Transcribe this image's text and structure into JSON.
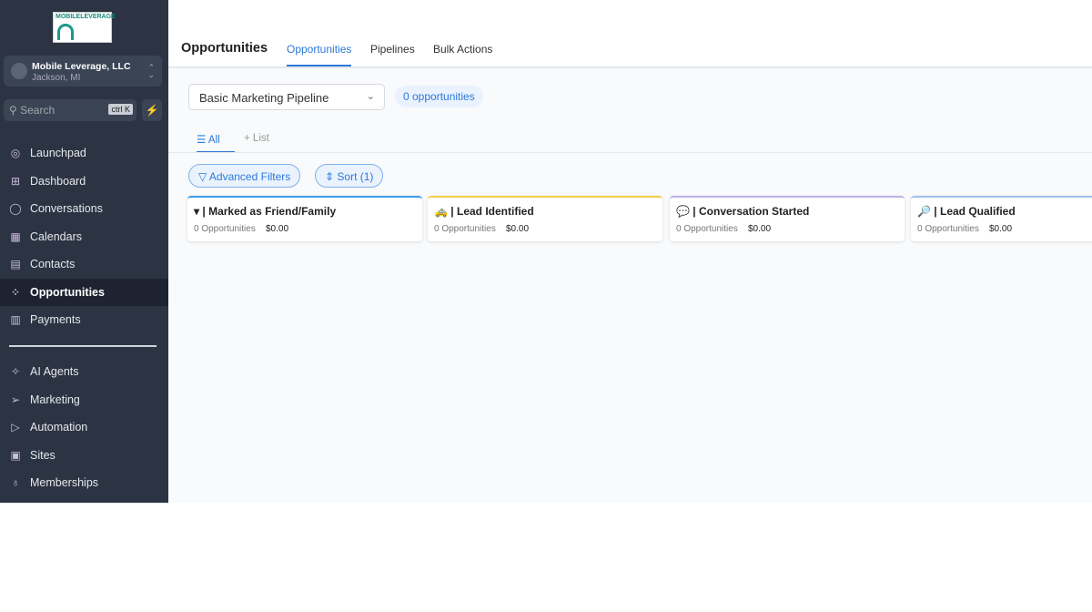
{
  "logo": {
    "text": "MOBILELEVERAGE"
  },
  "account": {
    "name": "Mobile Leverage, LLC",
    "location": "Jackson, MI"
  },
  "search": {
    "placeholder": "Search",
    "shortcut": "ctrl K"
  },
  "nav": [
    {
      "label": "Launchpad",
      "icon": "◎"
    },
    {
      "label": "Dashboard",
      "icon": "⊞"
    },
    {
      "label": "Conversations",
      "icon": "◯"
    },
    {
      "label": "Calendars",
      "icon": "▦"
    },
    {
      "label": "Contacts",
      "icon": "▤"
    },
    {
      "label": "Opportunities",
      "icon": "⁘",
      "active": true
    },
    {
      "label": "Payments",
      "icon": "▥"
    }
  ],
  "nav2": [
    {
      "label": "AI Agents",
      "icon": "✧"
    },
    {
      "label": "Marketing",
      "icon": "➢"
    },
    {
      "label": "Automation",
      "icon": "▷"
    },
    {
      "label": "Sites",
      "icon": "▣"
    },
    {
      "label": "Memberships",
      "icon": "♁"
    }
  ],
  "header": {
    "title": "Opportunities",
    "tabs": [
      "Opportunities",
      "Pipelines",
      "Bulk Actions"
    ]
  },
  "pipeline": {
    "selected": "Basic Marketing Pipeline",
    "count": "0 opportunities"
  },
  "views": {
    "all": "All",
    "list": "List"
  },
  "filters": {
    "advanced": "Advanced Filters",
    "sort": "Sort (1)"
  },
  "stages": [
    {
      "icon": "▾",
      "name": "| Marked as Friend/Family",
      "count": "0 Opportunities",
      "value": "$0.00",
      "color": "#3b9be8"
    },
    {
      "icon": "🚕",
      "name": "| Lead Identified",
      "count": "0 Opportunities",
      "value": "$0.00",
      "color": "#f2cc4a"
    },
    {
      "icon": "💬",
      "name": "| Conversation Started",
      "count": "0 Opportunities",
      "value": "$0.00",
      "color": "#b9b3e6"
    },
    {
      "icon": "🔎",
      "name": "| Lead Qualified",
      "count": "0 Opportunities",
      "value": "$0.00",
      "color": "#9cc2ef"
    }
  ]
}
